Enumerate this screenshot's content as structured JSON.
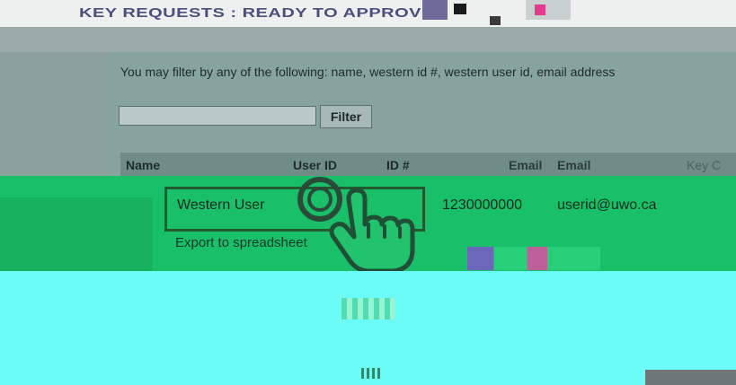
{
  "page": {
    "heading": "KEY REQUESTS : READY TO APPROVE"
  },
  "filter": {
    "hint": "You may filter by any of the following: name, western id #, western user id, email address",
    "input_value": "",
    "button_label": "Filter"
  },
  "table": {
    "columns": [
      "Name",
      "User ID",
      "ID #",
      "Email",
      "Email",
      "Key C"
    ],
    "rows": [
      {
        "name": "Western User",
        "id_number": "1230000000",
        "email": "userid@uwo.ca"
      }
    ],
    "export_label": "Export to spreadsheet"
  },
  "colors": {
    "heading": "#4a4f7e",
    "panel": "#86a39c",
    "highlight_green": "#1abf6a",
    "cyan": "#6bfcf8"
  },
  "icons": {
    "pointer": "hand-pointer-icon"
  }
}
